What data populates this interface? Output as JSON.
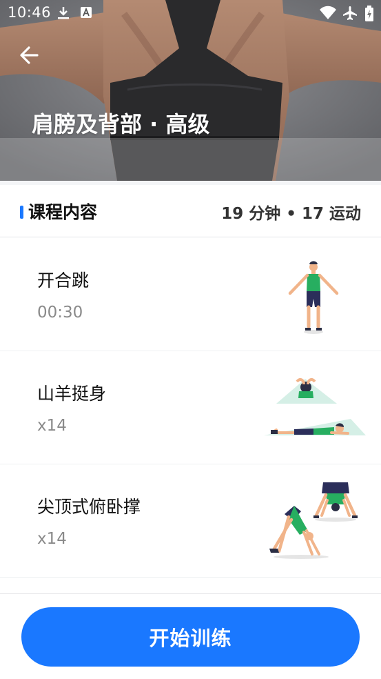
{
  "status_bar": {
    "time": "10:46",
    "icons": [
      "download-icon",
      "font-icon",
      "wifi-icon",
      "airplane-icon",
      "battery-icon"
    ]
  },
  "hero": {
    "title": "肩膀及背部 · 高级",
    "back_icon": "arrow-left-icon"
  },
  "section": {
    "title": "课程内容",
    "meta": "19 分钟 • 17 运动",
    "accent_color": "#1a78ff"
  },
  "exercises": [
    {
      "name": "开合跳",
      "detail": "00:30",
      "illustration": "jumping-jack-figure"
    },
    {
      "name": "山羊挺身",
      "detail": "x14",
      "illustration": "prone-back-extension-figure"
    },
    {
      "name": "尖顶式俯卧撑",
      "detail": "x14",
      "illustration": "pike-pushup-figure"
    }
  ],
  "start_button": {
    "label": "开始训练",
    "color": "#1a78ff"
  }
}
